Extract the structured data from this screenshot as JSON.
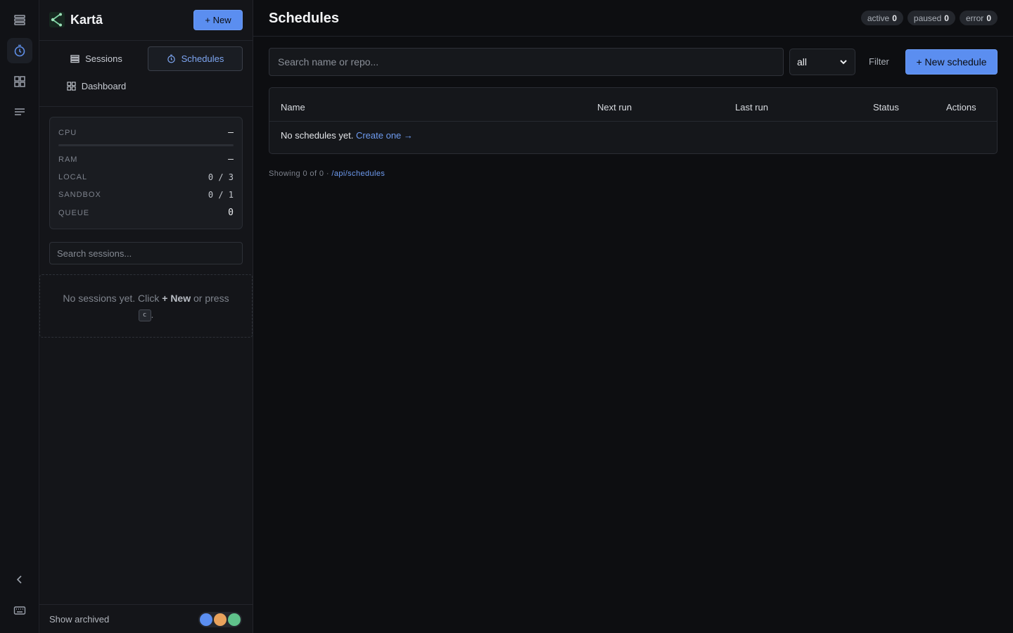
{
  "rail": {
    "items": [
      {
        "icon": "list-icon"
      },
      {
        "icon": "clock-icon",
        "active": true
      },
      {
        "icon": "dashboard-icon"
      },
      {
        "icon": "log-icon"
      }
    ],
    "bottom": [
      {
        "icon": "collapse-icon"
      },
      {
        "icon": "keyboard-icon"
      }
    ]
  },
  "sidebar": {
    "brand": "Kartā",
    "new_label": "+ New",
    "tabs": [
      {
        "label": "Sessions",
        "icon": "list-icon"
      },
      {
        "label": "Schedules",
        "icon": "clock-icon",
        "active": true
      },
      {
        "label": "Dashboard",
        "icon": "dashboard-icon"
      }
    ],
    "stats": {
      "cpu": {
        "label": "CPU",
        "value": "—"
      },
      "ram": {
        "label": "RAM",
        "value": "—"
      },
      "local": {
        "label": "LOCAL",
        "value": "0 / 3"
      },
      "sandbox": {
        "label": "SANDBOX",
        "value": "0 / 1"
      },
      "queue": {
        "label": "QUEUE",
        "value": "0"
      }
    },
    "search_placeholder": "Search sessions...",
    "empty": {
      "text_before": "No sessions yet. Click ",
      "bold": "+ New",
      "text_after": " or press",
      "key": "c",
      "end": "."
    },
    "footer": {
      "archived_label": "Show archived",
      "colors": [
        "#5b8ef0",
        "#e8a25c",
        "#5fc18a"
      ]
    }
  },
  "main": {
    "title": "Schedules",
    "badges": [
      {
        "label": "active",
        "count": "0"
      },
      {
        "label": "paused",
        "count": "0"
      },
      {
        "label": "error",
        "count": "0"
      }
    ],
    "search_placeholder": "Search name or repo...",
    "filter_select": "all",
    "filter_label": "Filter",
    "new_schedule_label": "+ New schedule",
    "table": {
      "columns": [
        "Name",
        "Next run",
        "Last run",
        "Status",
        "Actions"
      ],
      "empty_text": "No schedules yet. ",
      "empty_link": "Create one →"
    },
    "footer": {
      "showing": "Showing 0 of 0 · ",
      "link": "/api/schedules"
    }
  },
  "colors": {
    "accent": "#5b8ef0",
    "background": "#0d0e11"
  }
}
